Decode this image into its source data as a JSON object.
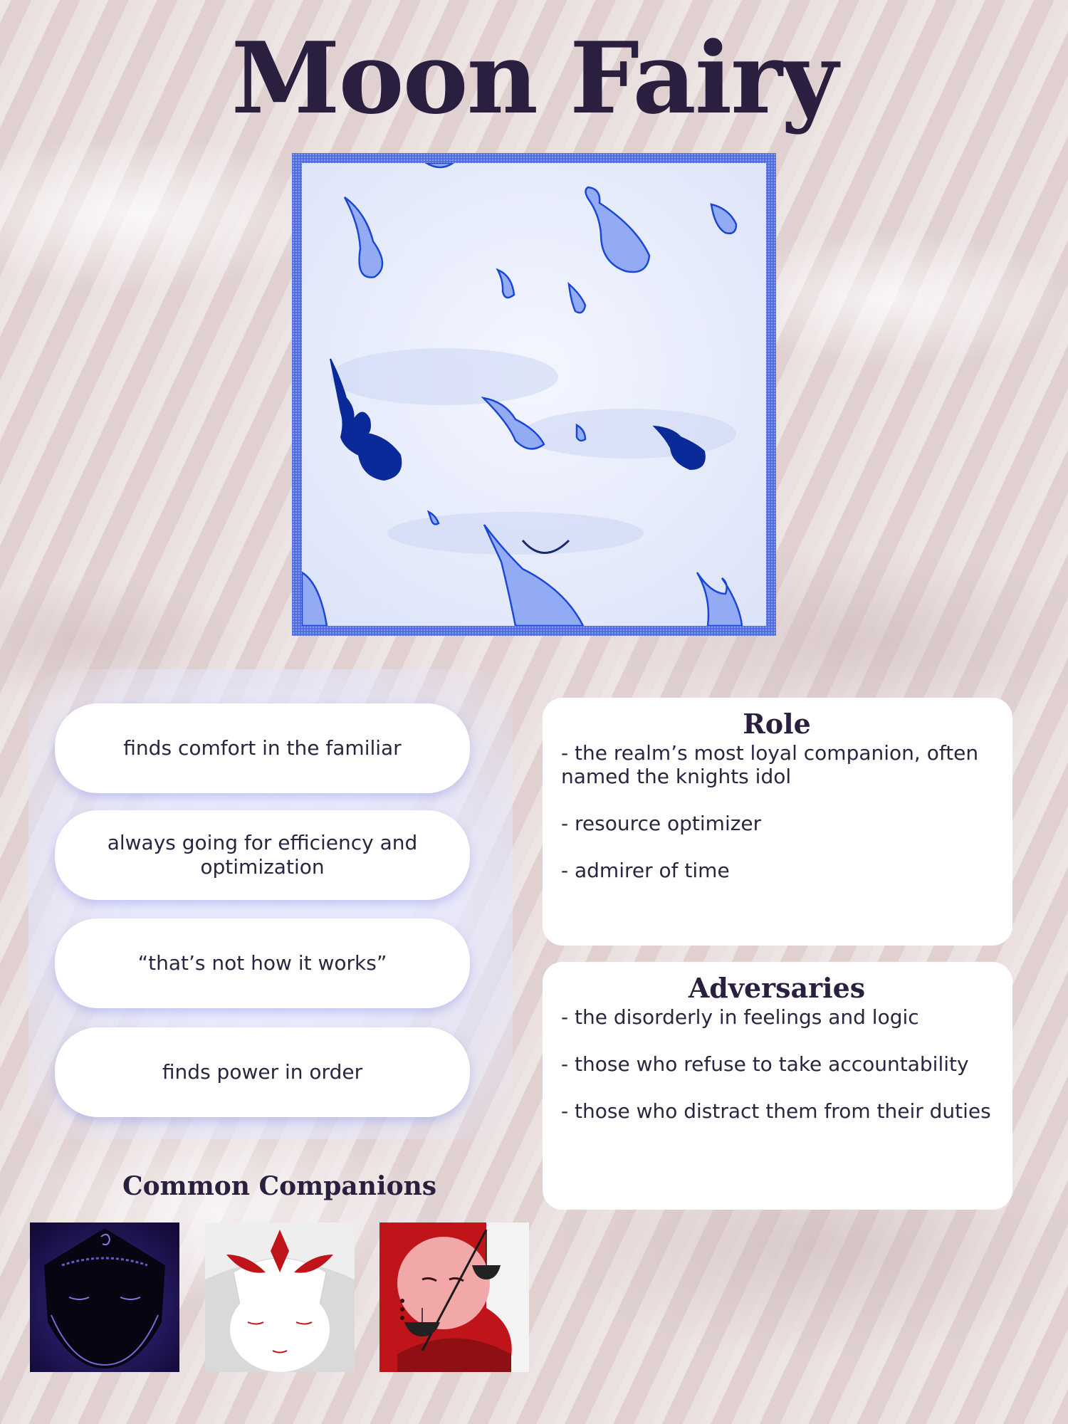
{
  "title": "Moon Fairy",
  "traits": [
    "finds comfort in the familiar",
    "always going for efficiency and optimization",
    "“that’s not how it works”",
    "finds power in order"
  ],
  "role": {
    "heading": "Role",
    "items": [
      "- the realm’s most loyal companion, often named the knights idol",
      "- resource optimizer",
      "- admirer of time"
    ]
  },
  "adversaries": {
    "heading": "Adversaries",
    "items": [
      "- the disorderly in feelings and logic",
      "- those who refuse to take accountability",
      "- those who distract them from their duties"
    ]
  },
  "companions": {
    "heading": "Common Companions",
    "items": [
      {
        "name": "dark-companion-portrait"
      },
      {
        "name": "white-red-companion-portrait"
      },
      {
        "name": "scales-companion-portrait"
      }
    ]
  },
  "colors": {
    "ink": "#2b1f3f",
    "frame_blue": "#4d6be0",
    "drop_light": "#93aaf5",
    "drop_dark": "#0a2a9a",
    "accent_red": "#c0141b"
  }
}
